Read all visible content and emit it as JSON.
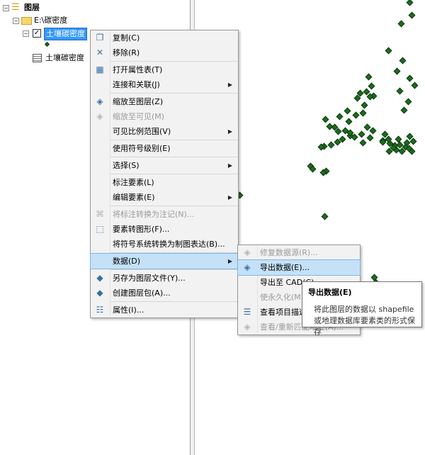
{
  "toc": {
    "root_label": "图层",
    "folder_label": "E:\\碳密度",
    "layer_label": "土壤碳密度",
    "table_label": "土壤碳密度"
  },
  "context_menu": {
    "items": [
      {
        "label": "复制(C)",
        "icon": "copy-icon",
        "glyph": "❐"
      },
      {
        "label": "移除(R)",
        "icon": "remove-icon",
        "glyph": "✕"
      },
      {
        "label": "打开属性表(T)",
        "icon": "attribute-table-icon",
        "glyph": "▦"
      },
      {
        "label": "连接和关联(J)",
        "submenu": true
      },
      {
        "label": "缩放至图层(Z)",
        "icon": "zoom-to-layer-icon",
        "glyph": "◈"
      },
      {
        "label": "缩放至可见(M)",
        "icon": "zoom-to-visible-icon",
        "glyph": "◈",
        "disabled": true
      },
      {
        "label": "可见比例范围(V)",
        "submenu": true
      },
      {
        "label": "使用符号级别(E)"
      },
      {
        "label": "选择(S)",
        "submenu": true
      },
      {
        "label": "标注要素(L)"
      },
      {
        "label": "编辑要素(E)",
        "submenu": true
      },
      {
        "label": "将标注转换为注记(N)...",
        "icon": "convert-labels-icon",
        "glyph": "⌘",
        "disabled": true
      },
      {
        "label": "要素转图形(F)...",
        "icon": "features-to-graphics-icon",
        "glyph": "⬚"
      },
      {
        "label": "将符号系统转换为制图表达(B)..."
      },
      {
        "label": "数据(D)",
        "submenu": true,
        "highlighted": true
      },
      {
        "label": "另存为图层文件(Y)...",
        "icon": "layer-file-icon",
        "glyph": "◆"
      },
      {
        "label": "创建图层包(A)...",
        "icon": "layer-package-icon",
        "glyph": "◆"
      },
      {
        "label": "属性(I)...",
        "icon": "properties-icon",
        "glyph": "☷"
      }
    ]
  },
  "data_submenu": {
    "items": [
      {
        "label": "修复数据源(R)...",
        "icon": "repair-data-source-icon",
        "glyph": "◈",
        "disabled": true
      },
      {
        "label": "导出数据(E)...",
        "icon": "export-data-icon",
        "glyph": "◈",
        "highlighted": true
      },
      {
        "label": "导出至 CAD(C)..."
      },
      {
        "label": "使永久化(M)",
        "disabled": true
      },
      {
        "label": "查看项目描述(V)",
        "icon": "item-description-icon",
        "glyph": "☰"
      },
      {
        "label": "查看/重新匹配地址(A)...",
        "icon": "review-rematch-icon",
        "glyph": "◈",
        "disabled": true
      }
    ]
  },
  "tooltip": {
    "title": "导出数据(E)",
    "line1": "将此图层的数据以 shapefile",
    "line2": "或地理数据库要素类的形式保存"
  },
  "colors": {
    "point_fill": "#1f6b1f",
    "menu_highlight": "#c4e1f8",
    "selection": "#3399ff"
  }
}
